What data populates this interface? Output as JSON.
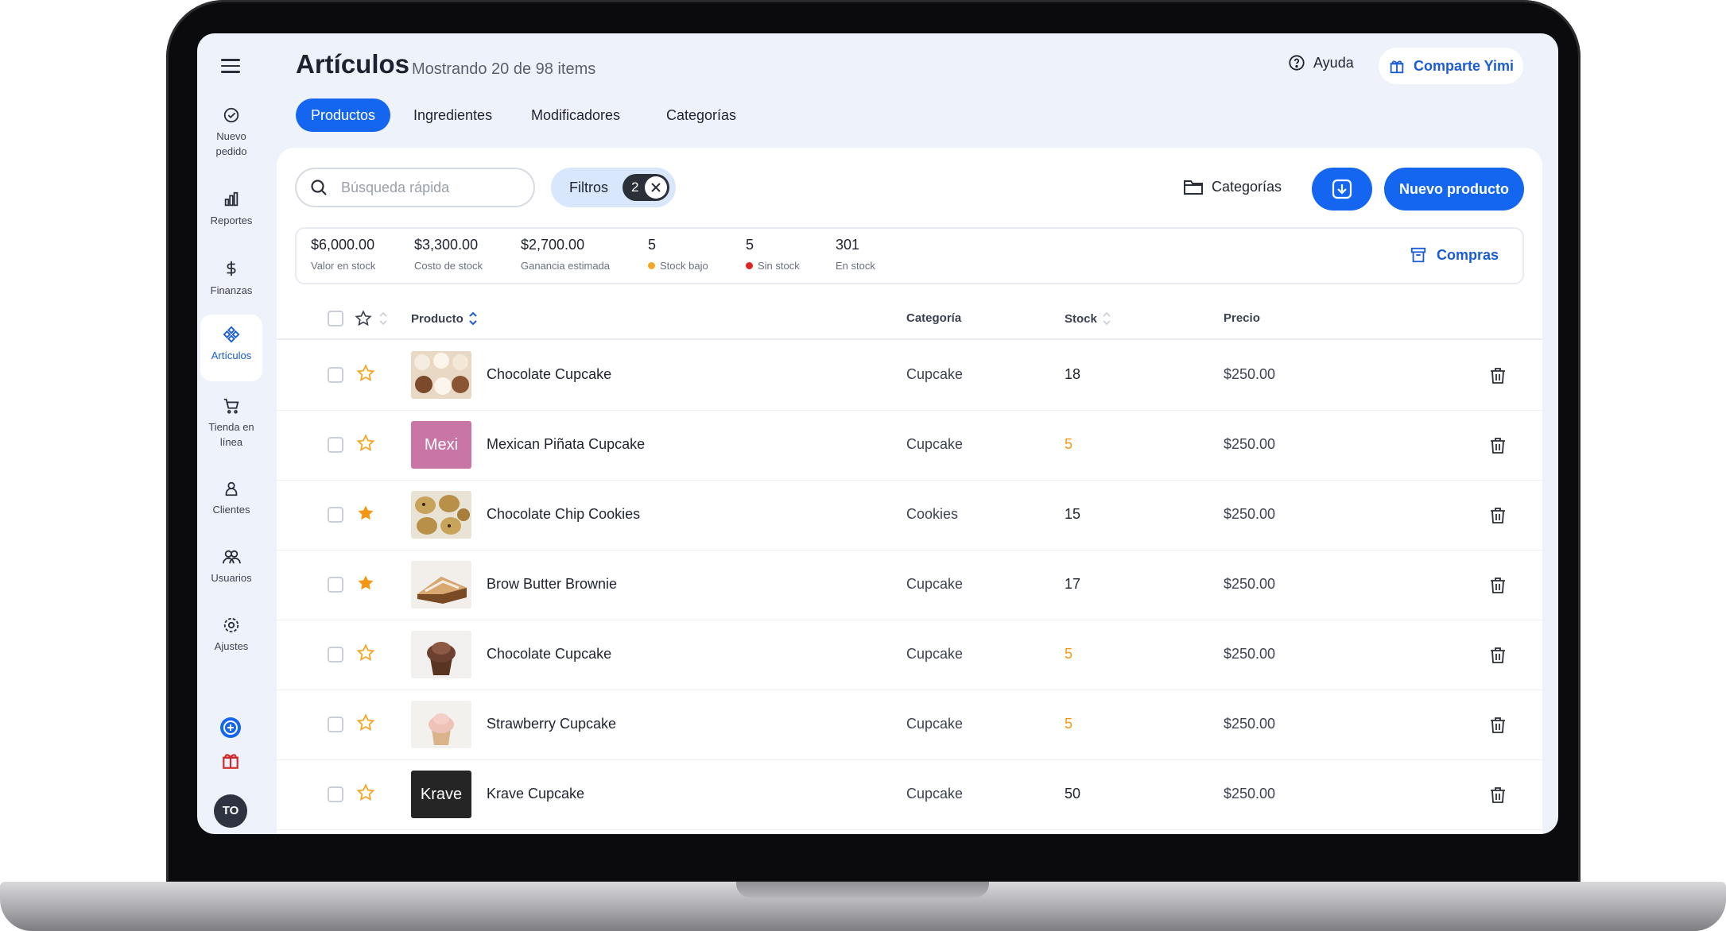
{
  "header": {
    "title": "Artículos",
    "subtitle": "Mostrando 20 de 98 items",
    "help_label": "Ayuda",
    "share_label": "Comparte Yimi"
  },
  "sidebar": {
    "items": [
      {
        "label": "Nuevo pedido",
        "icon": "check-circle-icon"
      },
      {
        "label": "Reportes",
        "icon": "bar-chart-icon"
      },
      {
        "label": "Finanzas",
        "icon": "dollar-icon"
      },
      {
        "label": "Artículos",
        "icon": "diamond-grid-icon",
        "active": true
      },
      {
        "label": "Tienda en línea",
        "icon": "cart-icon"
      },
      {
        "label": "Clientes",
        "icon": "person-icon"
      },
      {
        "label": "Usuarios",
        "icon": "users-icon"
      },
      {
        "label": "Ajustes",
        "icon": "gear-icon"
      }
    ],
    "avatar_initials": "TO"
  },
  "tabs": [
    {
      "label": "Productos",
      "active": true
    },
    {
      "label": "Ingredientes"
    },
    {
      "label": "Modificadores"
    },
    {
      "label": "Categorías"
    }
  ],
  "toolbar": {
    "search_placeholder": "Búsqueda rápida",
    "filters_label": "Filtros",
    "filters_count": "2",
    "categories_label": "Categorías",
    "new_product_label": "Nuevo producto"
  },
  "stats": {
    "items": [
      {
        "value": "$6,000.00",
        "label": "Valor en stock"
      },
      {
        "value": "$3,300.00",
        "label": "Costo de stock"
      },
      {
        "value": "$2,700.00",
        "label": "Ganancia estimada"
      },
      {
        "value": "5",
        "label": "Stock bajo",
        "dot": "#f5a623"
      },
      {
        "value": "5",
        "label": "Sin stock",
        "dot": "#e02424"
      },
      {
        "value": "301",
        "label": "En stock"
      }
    ],
    "purchases_label": "Compras"
  },
  "table": {
    "headers": {
      "product": "Producto",
      "category": "Categoría",
      "stock": "Stock",
      "price": "Precio"
    },
    "rows": [
      {
        "name": "Chocolate Cupcake",
        "category": "Cupcake",
        "stock": "18",
        "price": "$250.00",
        "favorite": false,
        "low": false
      },
      {
        "name": "Mexican Piñata Cupcake",
        "category": "Cupcake",
        "stock": "5",
        "price": "$250.00",
        "favorite": false,
        "low": true,
        "thumb_text": "Mexi"
      },
      {
        "name": "Chocolate Chip Cookies",
        "category": "Cookies",
        "stock": "15",
        "price": "$250.00",
        "favorite": true,
        "low": false
      },
      {
        "name": "Brow Butter Brownie",
        "category": "Cupcake",
        "stock": "17",
        "price": "$250.00",
        "favorite": true,
        "low": false
      },
      {
        "name": "Chocolate Cupcake",
        "category": "Cupcake",
        "stock": "5",
        "price": "$250.00",
        "favorite": false,
        "low": true
      },
      {
        "name": "Strawberry Cupcake",
        "category": "Cupcake",
        "stock": "5",
        "price": "$250.00",
        "favorite": false,
        "low": true
      },
      {
        "name": "Krave Cupcake",
        "category": "Cupcake",
        "stock": "50",
        "price": "$250.00",
        "favorite": false,
        "low": false,
        "thumb_text": "Krave"
      }
    ]
  },
  "colors": {
    "accent": "#1466f0",
    "low_stock": "#f5960f",
    "out_of_stock": "#e02424",
    "star": "#f5960f"
  }
}
